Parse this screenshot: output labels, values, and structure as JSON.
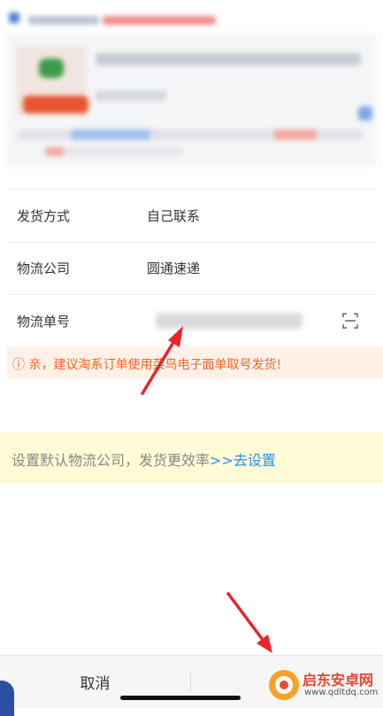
{
  "form": {
    "shipping_method": {
      "label": "发货方式",
      "value": "自己联系"
    },
    "logistics_company": {
      "label": "物流公司",
      "value": "圆通速递"
    },
    "tracking_number": {
      "label": "物流单号"
    }
  },
  "tip": {
    "text": "ⓘ 亲，建议淘系订单使用菜鸟电子面单取号发货!"
  },
  "default_logistics": {
    "text": "设置默认物流公司，发货更效率",
    "link": ">>去设置"
  },
  "actions": {
    "cancel_label": "取消"
  },
  "watermark": {
    "title": "启东安卓网",
    "url": "www.qdltdq.com"
  },
  "colors": {
    "tip_text": "#f26722",
    "link": "#2d8ff0",
    "arrow": "#e8242a",
    "default_bar_bg": "#fefbd6"
  },
  "icons": [
    "scan-icon",
    "info-icon",
    "watermark-logo-icon"
  ]
}
